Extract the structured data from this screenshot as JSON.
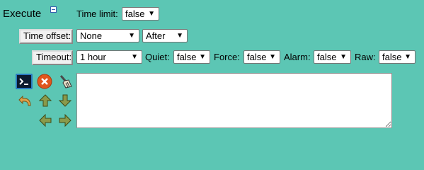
{
  "header": {
    "title": "Execute",
    "time_limit_label": "Time limit:",
    "time_limit_value": "false"
  },
  "time_offset": {
    "button_label": "Time offset:",
    "offset_value": "None",
    "relation_value": "After"
  },
  "timeout": {
    "button_label": "Timeout:",
    "timeout_value": "1 hour",
    "quiet_label": "Quiet:",
    "quiet_value": "false",
    "force_label": "Force:",
    "force_value": "false",
    "alarm_label": "Alarm:",
    "alarm_value": "false",
    "raw_label": "Raw:",
    "raw_value": "false"
  },
  "command": {
    "value": ""
  },
  "icons": [
    "terminal-icon",
    "cancel-icon",
    "clear-brush-icon",
    "undo-icon",
    "arrow-up-icon",
    "arrow-down-icon",
    "arrow-left-icon",
    "arrow-right-icon"
  ],
  "colors": {
    "background": "#5cc6b4",
    "cancel_orange": "#e0561c",
    "arrow_olive": "#8a9a4a"
  }
}
